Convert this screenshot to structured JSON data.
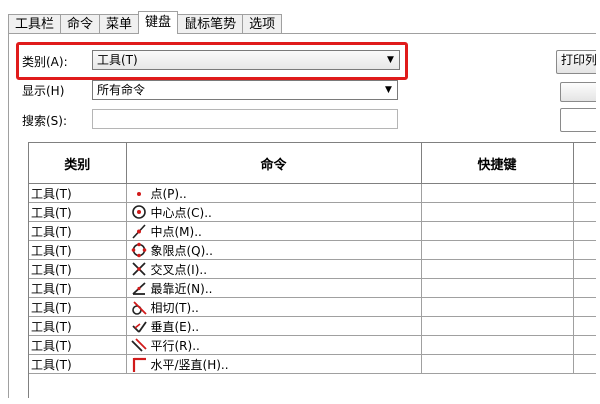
{
  "tabs": [
    {
      "label": "工具栏",
      "active": false
    },
    {
      "label": "命令",
      "active": false
    },
    {
      "label": "菜单",
      "active": false
    },
    {
      "label": "键盘",
      "active": true
    },
    {
      "label": "鼠标笔势",
      "active": false
    },
    {
      "label": "选项",
      "active": false
    }
  ],
  "category": {
    "label": "类别(A):",
    "value": "工具(T)"
  },
  "display": {
    "label": "显示(H)",
    "value": "所有命令"
  },
  "search": {
    "label": "搜索(S):",
    "value": ""
  },
  "print_button": "打印列",
  "table": {
    "headers": {
      "category": "类别",
      "command": "命令",
      "shortcut": "快捷键"
    },
    "rows": [
      {
        "category": "工具(T)",
        "command": "点(P)..",
        "icon": "point-icon",
        "shortcut": ""
      },
      {
        "category": "工具(T)",
        "command": "中心点(C)..",
        "icon": "center-point-icon",
        "shortcut": ""
      },
      {
        "category": "工具(T)",
        "command": "中点(M)..",
        "icon": "midpoint-icon",
        "shortcut": ""
      },
      {
        "category": "工具(T)",
        "command": "象限点(Q)..",
        "icon": "quadrant-point-icon",
        "shortcut": ""
      },
      {
        "category": "工具(T)",
        "command": "交叉点(I)..",
        "icon": "intersection-icon",
        "shortcut": ""
      },
      {
        "category": "工具(T)",
        "command": "最靠近(N)..",
        "icon": "nearest-icon",
        "shortcut": ""
      },
      {
        "category": "工具(T)",
        "command": "相切(T)..",
        "icon": "tangent-icon",
        "shortcut": ""
      },
      {
        "category": "工具(T)",
        "command": "垂直(E)..",
        "icon": "perpendicular-icon",
        "shortcut": ""
      },
      {
        "category": "工具(T)",
        "command": "平行(R)..",
        "icon": "parallel-icon",
        "shortcut": ""
      },
      {
        "category": "工具(T)",
        "command": "水平/竖直(H)..",
        "icon": "horizontal-vertical-icon",
        "shortcut": ""
      }
    ]
  },
  "colors": {
    "highlight": "#e01b1b",
    "icon_red": "#d11a1a",
    "icon_dark": "#222222"
  }
}
